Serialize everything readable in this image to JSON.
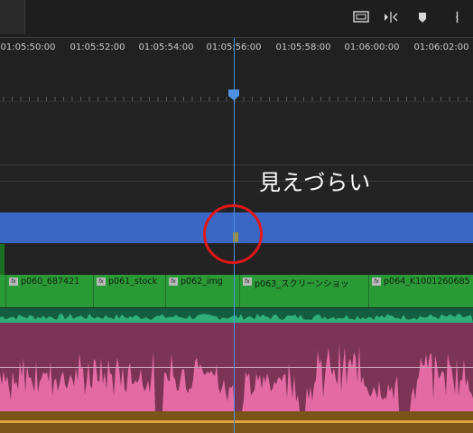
{
  "toolbar": {
    "icons": [
      "monitor-icon",
      "insert-icon",
      "marker-icon",
      "wrench-icon"
    ]
  },
  "ruler": {
    "timecodes": [
      "01:05:50:00",
      "01:05:52:00",
      "01:05:54:00",
      "01:05:56:00",
      "01:05:58:00",
      "01:06:00:00",
      "01:06:02:00"
    ]
  },
  "annotation": {
    "text": "見えづらい"
  },
  "clips": [
    {
      "name": "p060_687421"
    },
    {
      "name": "p061_stock"
    },
    {
      "name": "p062_img"
    },
    {
      "name": "p063_スクリーンショッ"
    },
    {
      "name": "p064_K1001260685"
    }
  ],
  "colors": {
    "video_clip": "#3a66c4",
    "clip_green": "#2a9a36",
    "audio_pink": "#e46aa4",
    "playhead": "#4d8fe0",
    "highlight_circle": "#e01818"
  }
}
